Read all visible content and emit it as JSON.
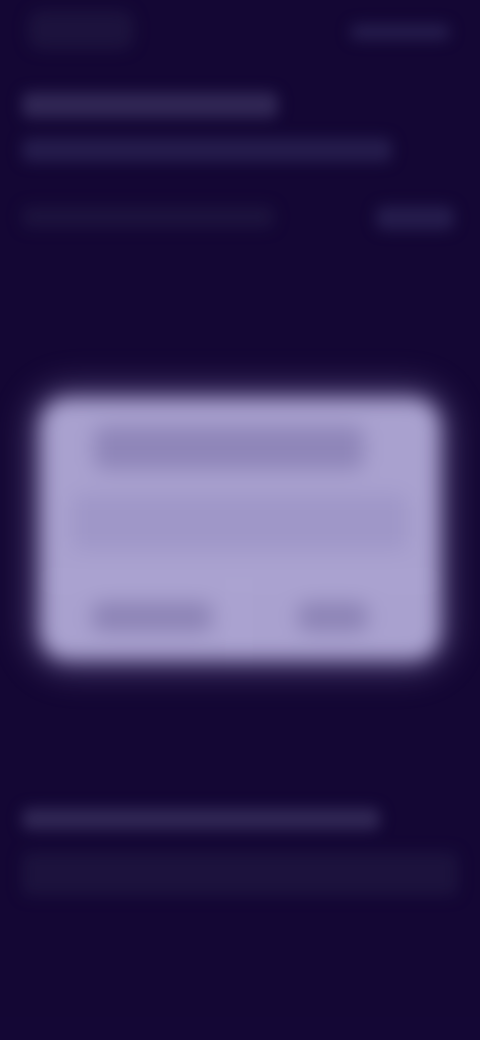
{
  "screen": {
    "note_visible_text": "",
    "background_color": "#140735",
    "modal_color": "#a9a1cf"
  },
  "header": {
    "left_logo_text": "",
    "right_action_text": ""
  },
  "page": {
    "title": "",
    "subtitle": "",
    "row_label": "",
    "row_action": ""
  },
  "dialog": {
    "title": "",
    "message": "",
    "buttons": [
      {
        "label": ""
      },
      {
        "label": ""
      }
    ]
  },
  "footer": {
    "text": ""
  }
}
